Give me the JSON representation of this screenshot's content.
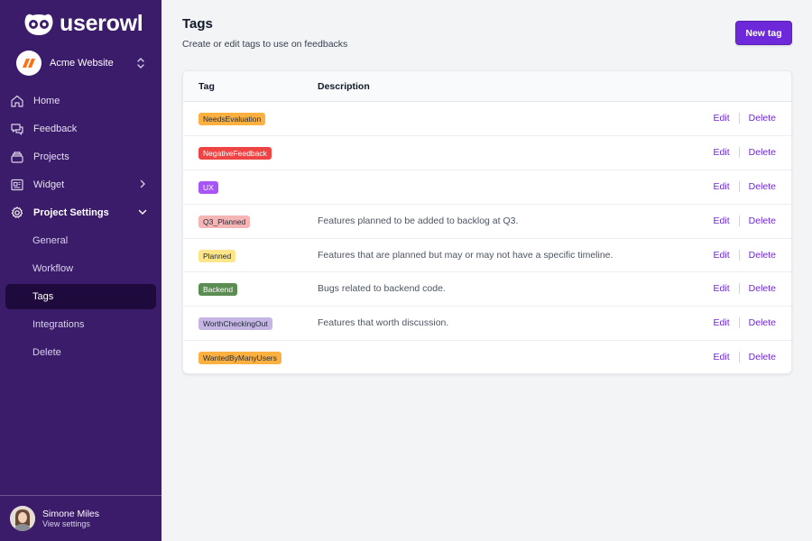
{
  "brand": {
    "name": "userowl"
  },
  "workspace": {
    "name": "Acme Website"
  },
  "nav": {
    "home": "Home",
    "feedback": "Feedback",
    "projects": "Projects",
    "widget": "Widget",
    "project_settings": "Project Settings",
    "sub": [
      "General",
      "Workflow",
      "Tags",
      "Integrations",
      "Delete"
    ]
  },
  "user": {
    "name": "Simone Miles",
    "sub": "View settings"
  },
  "page": {
    "title": "Tags",
    "subtitle": "Create or edit tags to use on feedbacks",
    "new_button": "New tag"
  },
  "table": {
    "headers": {
      "tag": "Tag",
      "description": "Description"
    },
    "edit_label": "Edit",
    "delete_label": "Delete",
    "rows": [
      {
        "tag": "NeedsEvaluation",
        "description": "",
        "bg": "#fbb040",
        "fg": "#1f2937"
      },
      {
        "tag": "NegativeFeedback",
        "description": "",
        "bg": "#ef4444",
        "fg": "#ffffff"
      },
      {
        "tag": "UX",
        "description": "",
        "bg": "#a855f7",
        "fg": "#ffffff"
      },
      {
        "tag": "Q3_Planned",
        "description": "Features planned to be added to backlog at Q3.",
        "bg": "#f5b5b5",
        "fg": "#1f2937"
      },
      {
        "tag": "Planned",
        "description": "Features that are planned but may or may not have a specific timeline.",
        "bg": "#fde68a",
        "fg": "#1f2937"
      },
      {
        "tag": "Backend",
        "description": "Bugs related to backend code.",
        "bg": "#5b8c51",
        "fg": "#ffffff"
      },
      {
        "tag": "WorthCheckingOut",
        "description": "Features that worth discussion.",
        "bg": "#c4b5e3",
        "fg": "#1f2937"
      },
      {
        "tag": "WantedByManyUsers",
        "description": "",
        "bg": "#fbb040",
        "fg": "#1f2937"
      }
    ]
  },
  "colors": {
    "sidebar": "#3a1c6b",
    "sidebar_selected": "#1e0a3d",
    "accent": "#6d28d9"
  }
}
